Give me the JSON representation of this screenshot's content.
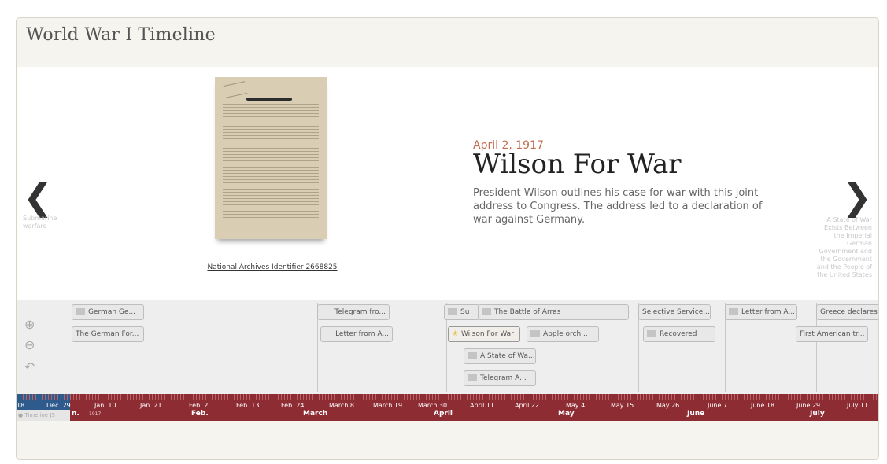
{
  "title": "World War I Timeline",
  "slide": {
    "date": "April 2, 1917",
    "heading": "Wilson For War",
    "description": "President Wilson outlines his case for war with this joint address to Congress.  The address led to a declaration of war against Germany.",
    "document_link": "National Archives Identifier 2668825",
    "prev_label": "Submarine warfare",
    "next_label": "A State of War Exists Between the Imperial German Government and the Government and the People of the United States",
    "prev_icon": "chevron-left-icon",
    "next_icon": "chevron-right-icon"
  },
  "zoom": {
    "zoom_in_icon": "zoom-in-icon",
    "zoom_out_icon": "zoom-out-icon",
    "back_icon": "back-arrow-icon"
  },
  "markers": [
    {
      "label": "German Ge..."
    },
    {
      "label": "The German For..."
    },
    {
      "label": "Telegram fro..."
    },
    {
      "label": "Letter from A..."
    },
    {
      "label": "Su"
    },
    {
      "label": "The Battle of Arras"
    },
    {
      "label": "Wilson For War"
    },
    {
      "label": "Apple orch..."
    },
    {
      "label": "A State of Wa..."
    },
    {
      "label": "Telegram A..."
    },
    {
      "label": "Selective Service..."
    },
    {
      "label": "Recovered"
    },
    {
      "label": "Letter from A..."
    },
    {
      "label": "Greece declares ..."
    },
    {
      "label": "First American tr..."
    }
  ],
  "axis": {
    "ticks": [
      "18",
      "Dec. 29",
      "Jan. 10",
      "Jan. 21",
      "Feb. 2",
      "Feb. 13",
      "Feb. 24",
      "March 8",
      "March 19",
      "March 30",
      "April 11",
      "April 22",
      "May 4",
      "May 15",
      "May 26",
      "June 7",
      "June 18",
      "June 29",
      "July 11"
    ],
    "months": [
      "n.",
      "Feb.",
      "March",
      "April",
      "May",
      "June",
      "July"
    ],
    "year": "1917",
    "timeline_tag": "Timeline JS"
  },
  "colors": {
    "axis_bg": "#8e2c33",
    "axis_left_bg": "#2f5a8c",
    "date_accent": "#c46b4e"
  }
}
